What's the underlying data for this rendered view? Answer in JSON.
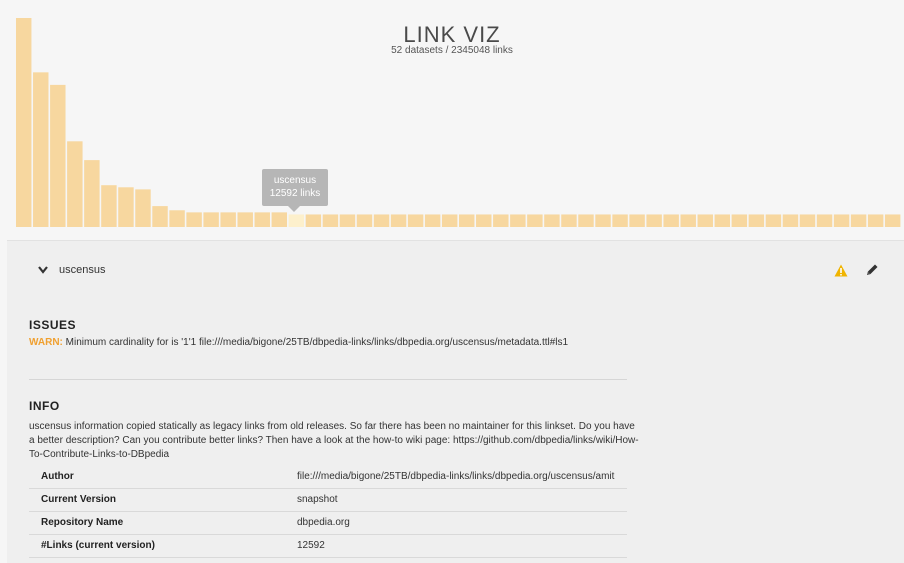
{
  "app": {
    "title": "LINK VIZ",
    "subtitle": "52 datasets / 2345048 links"
  },
  "chart_data": {
    "type": "bar",
    "values": [
      100,
      74,
      68,
      41,
      32,
      20,
      19,
      18,
      10,
      8,
      7,
      7,
      7,
      7,
      7,
      7,
      6,
      6,
      6,
      6,
      6,
      6,
      6,
      6,
      6,
      6,
      6,
      6,
      6,
      6,
      6,
      6,
      6,
      6,
      6,
      6,
      6,
      6,
      6,
      6,
      6,
      6,
      6,
      6,
      6,
      6,
      6,
      6,
      6,
      6,
      6,
      6
    ],
    "highlighted_index": 16,
    "bar_color": "#f7d79f",
    "highlight_color": "#fdf0cc",
    "tooltip": {
      "name": "uscensus",
      "count": "12592 links"
    }
  },
  "panel": {
    "dataset_name": "uscensus",
    "issues_title": "ISSUES",
    "warn_label": "WARN:",
    "warn_message": "Minimum cardinality for is '1'1 file:///media/bigone/25TB/dbpedia-links/links/dbpedia.org/uscensus/metadata.ttl#ls1",
    "info_title": "INFO",
    "info_text": "uscensus information copied statically as legacy links from old releases. So far there has been no maintainer for this linkset. Do you have a better description? Can you contribute better links? Then have a look at the how-to wiki page: https://github.com/dbpedia/links/wiki/How-To-Contribute-Links-to-DBpedia",
    "table": [
      {
        "key": "Author",
        "value": "file:///media/bigone/25TB/dbpedia-links/links/dbpedia.org/uscensus/amit"
      },
      {
        "key": "Current Version",
        "value": "snapshot"
      },
      {
        "key": "Repository Name",
        "value": "dbpedia.org"
      },
      {
        "key": "#Links (current version)",
        "value": "12592"
      }
    ],
    "icons": {
      "warning": "warning-icon",
      "edit": "pencil-icon",
      "chevron": "chevron-down-icon"
    },
    "colors": {
      "warn": "#f0a030"
    }
  }
}
